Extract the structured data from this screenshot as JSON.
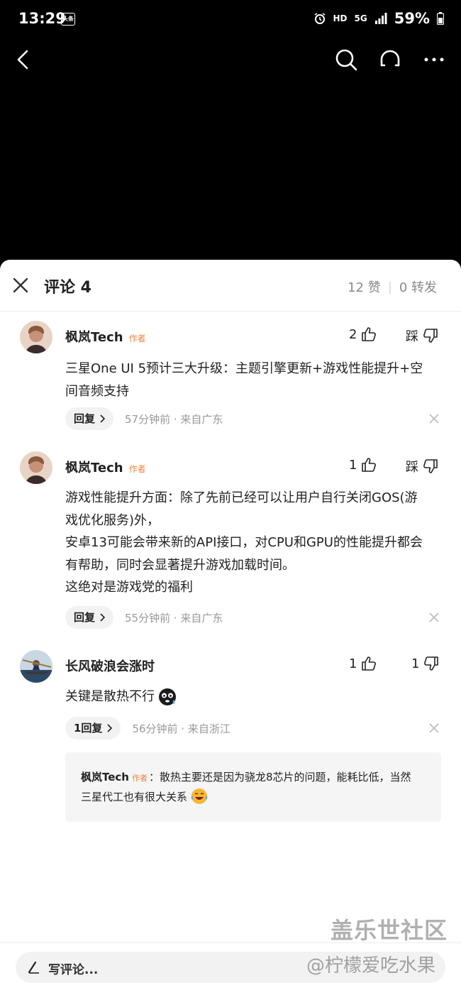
{
  "status_bar": {
    "time": "13:29",
    "app_badge": "头条",
    "network": "HD",
    "signal": "5G",
    "battery": "59%"
  },
  "video_bar": {
    "back_icon": "chevron-left-icon",
    "search_icon": "search-icon",
    "listen_icon": "headphones-icon",
    "more_icon": "more-horizontal-icon"
  },
  "comments_sheet": {
    "title": "评论 4",
    "likes_label": "12 赞",
    "shares_label": "0 转发"
  },
  "comments": [
    {
      "user": "枫岚Tech",
      "author_tag": "作者",
      "likes": "2",
      "dislike_label": "踩",
      "text_lines": [
        "三星One UI 5预计三大升级：主题引擎更新+游戏性能提升+空",
        "间音频支持"
      ],
      "reply_label": "回复",
      "meta": "57分钟前 · 来自广东"
    },
    {
      "user": "枫岚Tech",
      "author_tag": "作者",
      "likes": "1",
      "dislike_label": "踩",
      "text_lines": [
        "游戏性能提升方面：除了先前已经可以让用户自行关闭GOS(游",
        "戏优化服务)外，",
        "安卓13可能会带来新的API接口，对CPU和GPU的性能提升都会",
        "有帮助，同时会显著提升游戏加载时间。",
        "这绝对是游戏党的福利"
      ],
      "reply_label": "回复",
      "meta": "55分钟前 · 来自广东"
    },
    {
      "user": "长风破浪会涨时",
      "likes": "1",
      "dislikes": "1",
      "text": "关键是散热不行",
      "reply_label": "1回复",
      "meta": "56分钟前 · 来自浙江",
      "sub_reply": {
        "user": "枫岚Tech",
        "author_tag": "作者",
        "text_line1": "：散热主要还是因为骁龙8芯片的问题，能耗比低，当然",
        "text_line2": "三星代工也有很大关系"
      }
    }
  ],
  "footer": {
    "write_placeholder": "写评论..."
  },
  "watermarks": {
    "site": "盖乐世社区",
    "user": "@柠檬爱吃水果"
  },
  "colors": {
    "author_tag": "#f0813c",
    "meta_text": "#999999"
  }
}
